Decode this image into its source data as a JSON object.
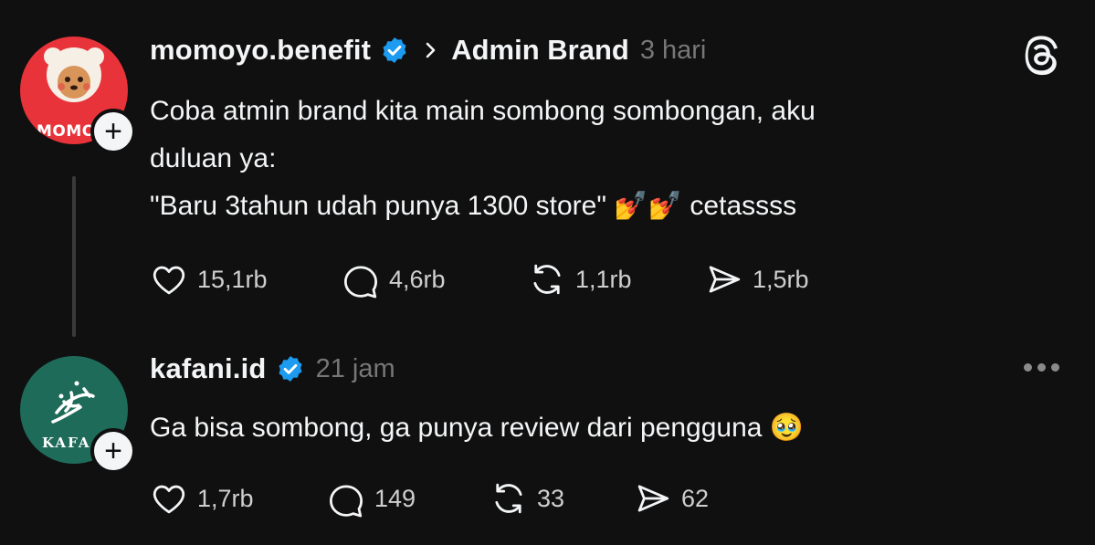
{
  "post1": {
    "username": "momoyo.benefit",
    "topic": "Admin Brand",
    "time": "3 hari",
    "avatar_text": "MOMO",
    "line1": "Coba atmin brand kita main sombong sombongan, aku",
    "line2": "duluan ya:",
    "line3_quote": "\"Baru 3tahun udah punya 1300 store\"",
    "line3_emoji": "💅💅",
    "line3_tail": "cetassss",
    "likes": "15,1rb",
    "replies": "4,6rb",
    "reposts": "1,1rb",
    "shares": "1,5rb"
  },
  "post2": {
    "username": "kafani.id",
    "time": "21 jam",
    "avatar_text": "KAFA",
    "text": "Ga bisa sombong, ga punya review dari pengguna",
    "emoji": "🥹",
    "likes": "1,7rb",
    "replies": "149",
    "reposts": "33",
    "shares": "62"
  },
  "icons": {
    "plus": "+",
    "verified_color": "#1d9bf0",
    "momoyo_brand_color": "#e8333a",
    "kafani_brand_color": "#1f6b5a"
  }
}
